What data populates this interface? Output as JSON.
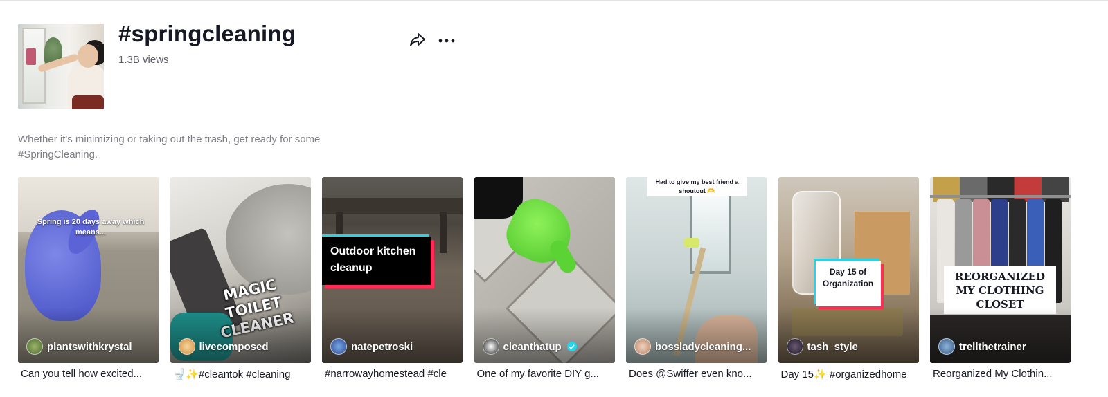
{
  "hashtag": {
    "title": "#springcleaning",
    "views": "1.3B views",
    "description": "Whether it's minimizing or taking out the trash, get ready for some #SpringCleaning.",
    "icons": {
      "share": "share-icon",
      "more": "more-icon"
    }
  },
  "videos": [
    {
      "overlay_text": "Spring is 20 days away which means...",
      "author": "plantswithkrystal",
      "verified": false,
      "caption": "Can you tell how excited..."
    },
    {
      "overlay_text": "MAGIC TOILET CLEANER",
      "author": "livecomposed",
      "verified": false,
      "caption": "🚽✨#cleantok #cleaning"
    },
    {
      "overlay_text": "Outdoor kitchen cleanup",
      "author": "natepetroski",
      "verified": false,
      "caption": "#narrowayhomestead #cle"
    },
    {
      "overlay_text": "",
      "author": "cleanthatup",
      "verified": true,
      "caption": "One of my favorite DIY g..."
    },
    {
      "overlay_text": "Had to give my best friend a shoutout 🫶",
      "author": "bossladycleaning...",
      "verified": false,
      "caption": "Does @Swiffer even kno..."
    },
    {
      "overlay_text": "Day 15 of Organization",
      "author": "tash_style",
      "verified": false,
      "caption": "Day 15✨ #organizedhome"
    },
    {
      "overlay_text": "REORGANIZED MY CLOTHING CLOSET",
      "author": "trellthetrainer",
      "verified": false,
      "caption": "Reorganized My Clothin..."
    }
  ],
  "colors": {
    "text_primary": "#161823",
    "text_secondary": "#7d7e84",
    "verified_badge": "#20d5ec"
  }
}
